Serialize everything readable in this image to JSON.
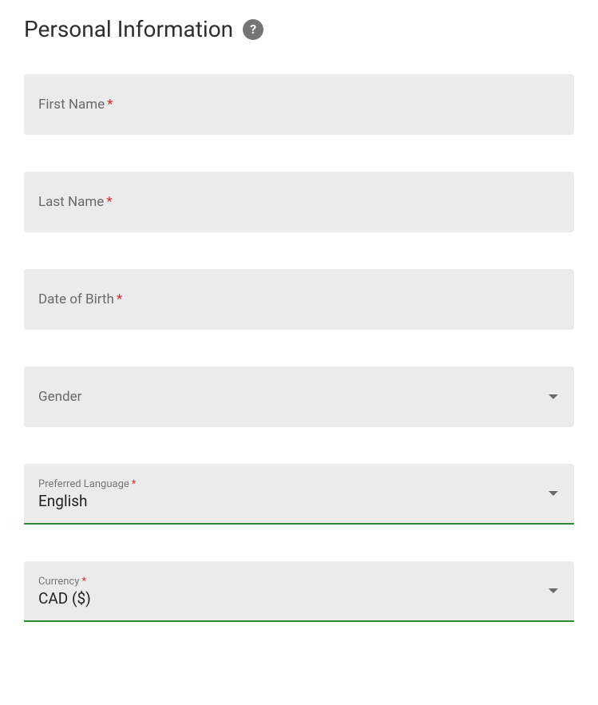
{
  "header": {
    "title": "Personal Information"
  },
  "fields": {
    "firstName": {
      "label": "First Name",
      "required": true
    },
    "lastName": {
      "label": "Last Name",
      "required": true
    },
    "dob": {
      "label": "Date of Birth",
      "required": true
    },
    "gender": {
      "label": "Gender",
      "required": false
    },
    "preferredLanguage": {
      "label": "Preferred Language",
      "required": true,
      "value": "English"
    },
    "currency": {
      "label": "Currency",
      "required": true,
      "value": "CAD ($)"
    }
  },
  "requiredMark": "*"
}
